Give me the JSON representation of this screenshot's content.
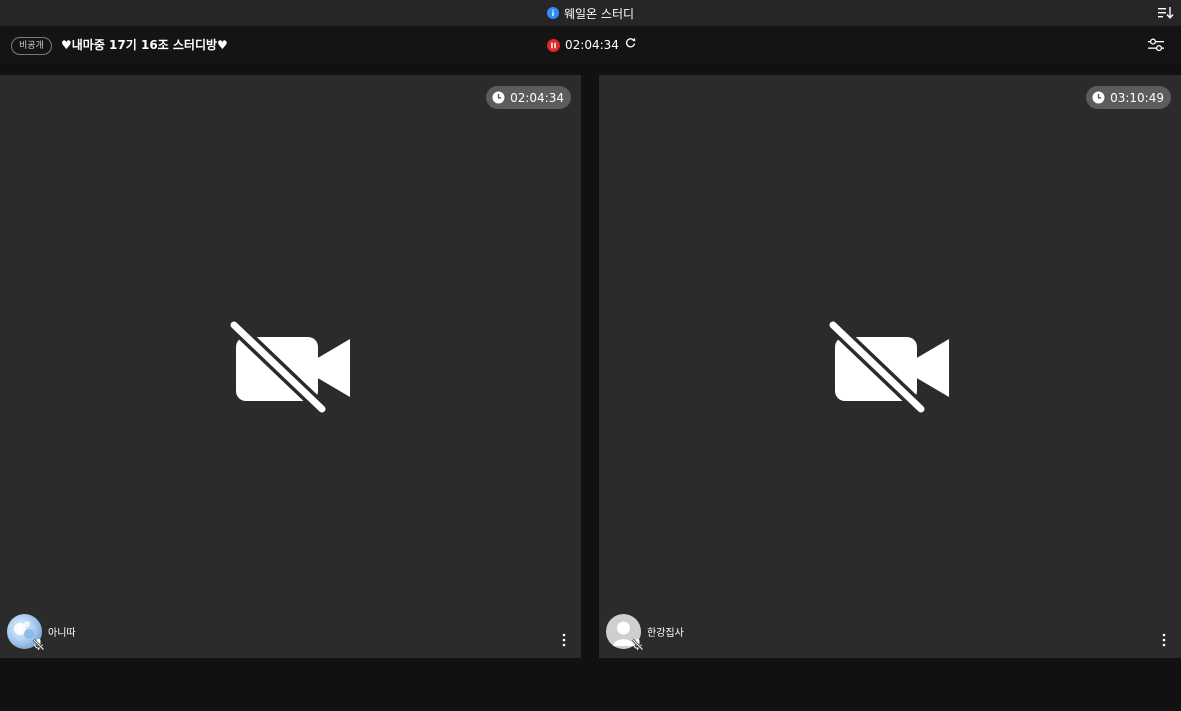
{
  "app": {
    "title": "웨일온 스터디"
  },
  "room": {
    "privacy_label": "비공개",
    "title": "♥내마중 17기 16조 스터디방♥",
    "elapsed": "02:04:34"
  },
  "participants": [
    {
      "name": "아니따",
      "timer": "02:04:34",
      "avatar": "photo",
      "camera": "off",
      "mic": "off"
    },
    {
      "name": "한강집사",
      "timer": "03:10:49",
      "avatar": "default",
      "camera": "off",
      "mic": "off"
    }
  ],
  "colors": {
    "info_blue": "#2f8cf6",
    "record_red": "#e02828",
    "tile_bg": "#2b2b2b",
    "pill_bg": "#5c5c5c"
  },
  "icons": {
    "title": "info-icon",
    "sort": "sort-icon",
    "timer": "pause-icon",
    "refresh": "refresh-icon",
    "settings": "settings-sliders-icon",
    "clock": "clock-icon",
    "camera": "video-off-icon",
    "mic": "mic-off-icon",
    "more": "more-vertical-icon"
  }
}
